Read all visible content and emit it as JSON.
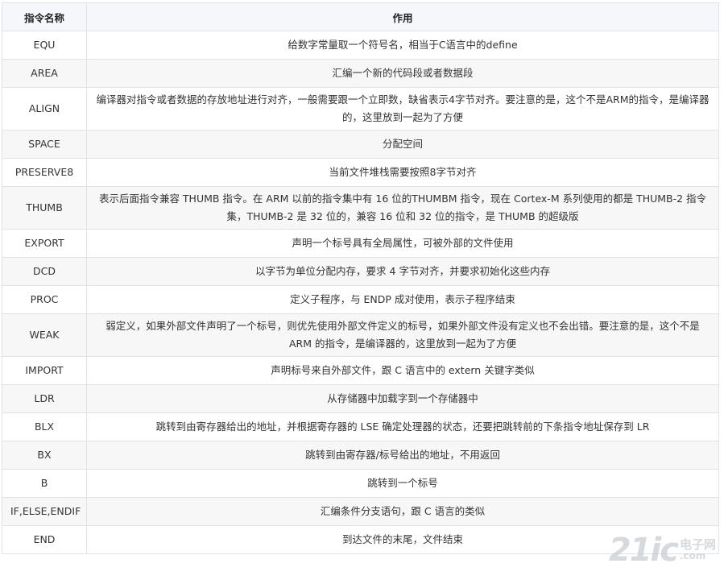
{
  "table": {
    "headers": [
      "指令名称",
      "作用"
    ],
    "rows": [
      {
        "name": "EQU",
        "desc": "给数字常量取一个符号名，相当于C语言中的define"
      },
      {
        "name": "AREA",
        "desc": "汇编一个新的代码段或者数据段"
      },
      {
        "name": "ALIGN",
        "desc": "编译器对指令或者数据的存放地址进行对齐，一般需要跟一个立即数，缺省表示4字节对齐。要注意的是，这个不是ARM的指令，是编译器的，这里放到一起为了方便"
      },
      {
        "name": "SPACE",
        "desc": "分配空间"
      },
      {
        "name": "PRESERVE8",
        "desc": "当前文件堆栈需要按照8字节对齐"
      },
      {
        "name": "THUMB",
        "desc": "表示后面指令兼容 THUMB 指令。在 ARM 以前的指令集中有 16 位的THUMBM 指令，现在 Cortex-M 系列使用的都是 THUMB-2 指令集，THUMB-2 是 32 位的，兼容 16 位和 32 位的指令，是 THUMB 的超级版"
      },
      {
        "name": "EXPORT",
        "desc": "声明一个标号具有全局属性，可被外部的文件使用"
      },
      {
        "name": "DCD",
        "desc": "以字节为单位分配内存，要求 4 字节对齐，并要求初始化这些内存"
      },
      {
        "name": "PROC",
        "desc": "定义子程序，与 ENDP 成对使用，表示子程序结束"
      },
      {
        "name": "WEAK",
        "desc": "弱定义，如果外部文件声明了一个标号，则优先使用外部文件定义的标号，如果外部文件没有定义也不会出错。要注意的是，这个不是 ARM 的指令，是编译器的，这里放到一起为了方便"
      },
      {
        "name": "IMPORT",
        "desc": "声明标号来自外部文件，跟 C 语言中的 extern 关键字类似"
      },
      {
        "name": "LDR",
        "desc": "从存储器中加载字到一个存储器中"
      },
      {
        "name": "BLX",
        "desc": "跳转到由寄存器给出的地址，并根据寄存器的 LSE 确定处理器的状态，还要把跳转前的下条指令地址保存到 LR"
      },
      {
        "name": "BX",
        "desc": "跳转到由寄存器/标号给出的地址，不用返回"
      },
      {
        "name": "B",
        "desc": "跳转到一个标号"
      },
      {
        "name": "IF,ELSE,ENDIF",
        "desc": "汇编条件分支语句，跟 C 语言的类似"
      },
      {
        "name": "END",
        "desc": "到达文件的末尾，文件结束"
      }
    ]
  },
  "watermark": {
    "main": "21ic",
    "cn": "电子网",
    "domain": ".com"
  }
}
